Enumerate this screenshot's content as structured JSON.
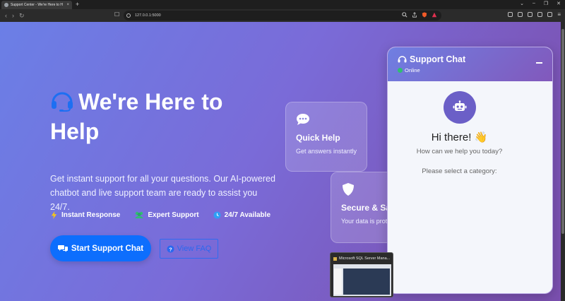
{
  "browser": {
    "tab_title": "Support Center - We're Here to H",
    "tab_close": "×",
    "new_tab": "+",
    "url": "127.0.0.1:5000",
    "window_controls": [
      "⌄",
      "–",
      "❐",
      "✕"
    ]
  },
  "hero": {
    "title": "We're Here to Help",
    "description": "Get instant support for all your questions. Our AI-powered chatbot and live support team are ready to assist you 24/7.",
    "features": [
      {
        "label": "Instant Response",
        "icon": "lightning-icon"
      },
      {
        "label": "Expert Support",
        "icon": "users-icon"
      },
      {
        "label": "24/7 Available",
        "icon": "clock-icon"
      }
    ],
    "primary_button": "Start Support Chat",
    "secondary_button": "View FAQ"
  },
  "cards": [
    {
      "title": "Quick Help",
      "subtitle": "Get answers instantly",
      "icon": "chat-bubble-icon"
    },
    {
      "title": "Secure & Safe",
      "subtitle": "Your data is protected",
      "icon": "shield-icon"
    }
  ],
  "taskbar_preview": {
    "title": "Microsoft SQL Server Mana..."
  },
  "chat": {
    "title": "Support Chat",
    "status": "Online",
    "greeting": "Hi there! 👋",
    "subtitle": "How can we help you today?",
    "category_prompt": "Please select a category:"
  },
  "colors": {
    "accent": "#0d6efd",
    "gradient_start": "#6b7fe6",
    "gradient_end": "#7a4fae",
    "online": "#2fbf71"
  }
}
